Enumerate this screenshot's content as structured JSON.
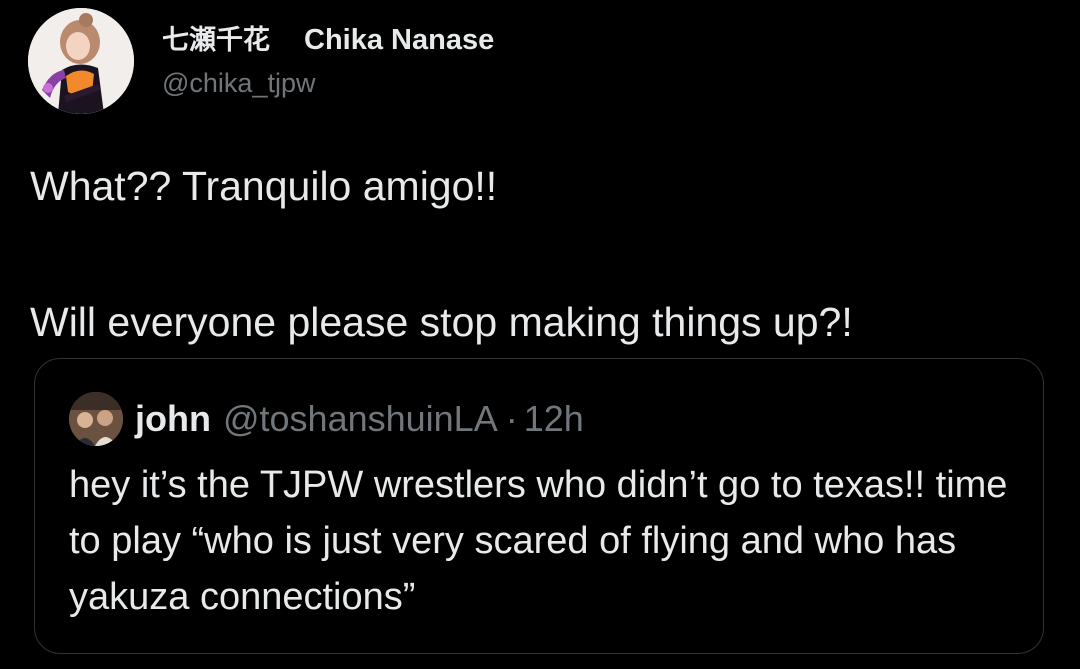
{
  "tweet": {
    "author": {
      "display_name_jp": "七瀬千花",
      "display_name_en": "Chika Nanase",
      "handle": "@chika_tjpw",
      "avatar_icon": "profile-avatar"
    },
    "text": "What?? Tranquilo amigo!!\n\nWill everyone please stop making things up?!",
    "quoted_tweet": {
      "author_name": "john",
      "author_handle": "@toshanshuinLA",
      "separator": "·",
      "time": "12h",
      "avatar_icon": "profile-avatar",
      "text": "hey it’s the TJPW wrestlers who didn’t go to texas!! time to play “who is just very scared of flying and who has yakuza connections”"
    }
  },
  "colors": {
    "background": "#000000",
    "primary_text": "#e7e9ea",
    "secondary_text": "#71767b",
    "card_border": "#2f3336"
  }
}
